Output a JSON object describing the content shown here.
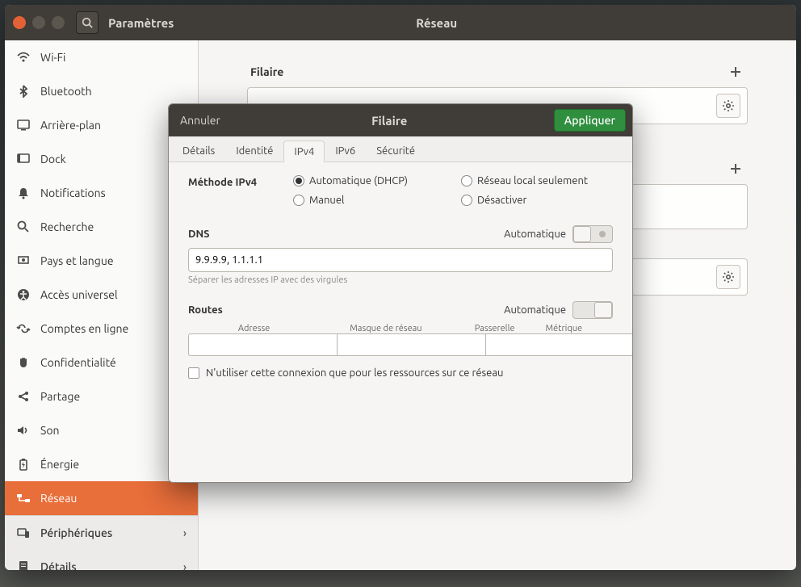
{
  "titlebar": {
    "app_label": "Paramètres",
    "page_title": "Réseau"
  },
  "sidebar": {
    "items": [
      {
        "id": "wifi",
        "label": "Wi-Fi"
      },
      {
        "id": "bluetooth",
        "label": "Bluetooth"
      },
      {
        "id": "background",
        "label": "Arrière-plan"
      },
      {
        "id": "dock",
        "label": "Dock"
      },
      {
        "id": "notifications",
        "label": "Notifications"
      },
      {
        "id": "search",
        "label": "Recherche"
      },
      {
        "id": "region",
        "label": "Pays et langue"
      },
      {
        "id": "accessibility",
        "label": "Accès universel"
      },
      {
        "id": "online-accounts",
        "label": "Comptes en ligne"
      },
      {
        "id": "privacy",
        "label": "Confidentialité"
      },
      {
        "id": "sharing",
        "label": "Partage"
      },
      {
        "id": "sound",
        "label": "Son"
      },
      {
        "id": "power",
        "label": "Énergie"
      },
      {
        "id": "network",
        "label": "Réseau"
      }
    ],
    "secondary": [
      {
        "id": "devices",
        "label": "Périphériques"
      },
      {
        "id": "details",
        "label": "Détails"
      }
    ]
  },
  "content": {
    "wired_section": "Filaire"
  },
  "dialog": {
    "cancel": "Annuler",
    "title": "Filaire",
    "apply": "Appliquer",
    "tabs": {
      "details": "Détails",
      "identity": "Identité",
      "ipv4": "IPv4",
      "ipv6": "IPv6",
      "security": "Sécurité"
    },
    "ipv4": {
      "method_label": "Méthode IPv4",
      "opt_dhcp": "Automatique (DHCP)",
      "opt_link_local": "Réseau local seulement",
      "opt_manual": "Manuel",
      "opt_disable": "Désactiver",
      "dns_label": "DNS",
      "auto_label": "Automatique",
      "dns_value": "9.9.9.9, 1.1.1.1",
      "dns_hint": "Séparer les adresses IP avec des virgules",
      "routes_label": "Routes",
      "col_address": "Adresse",
      "col_netmask": "Masque de réseau",
      "col_gateway": "Passerelle",
      "col_metric": "Métrique",
      "use_only_label": "N'utiliser cette connexion que pour les ressources sur ce réseau"
    }
  }
}
